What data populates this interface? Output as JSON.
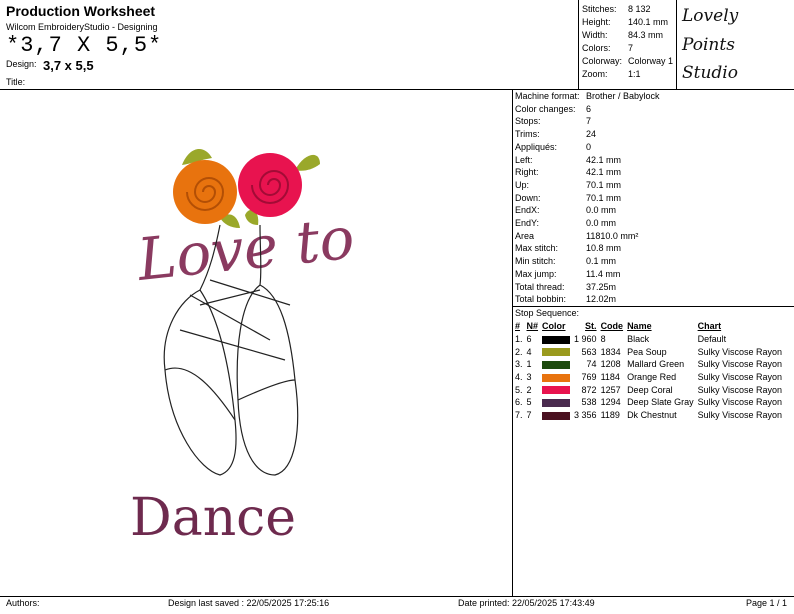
{
  "header": {
    "title": "Production Worksheet",
    "subtitle": "Wilcom EmbroideryStudio - Designing",
    "design_big": "*3,7 X 5,5*",
    "design_label": "Design:",
    "design_value": "3,7 x 5,5",
    "title_label": "Title:"
  },
  "summary": [
    {
      "label": "Stitches:",
      "value": "8 132"
    },
    {
      "label": "Height:",
      "value": "140.1 mm"
    },
    {
      "label": "Width:",
      "value": "84.3 mm"
    },
    {
      "label": "Colors:",
      "value": "7"
    },
    {
      "label": "Colorway:",
      "value": "Colorway 1"
    },
    {
      "label": "Zoom:",
      "value": "1:1"
    }
  ],
  "logo": {
    "line1": "Lovely",
    "line2": "Points",
    "line3": "Studio"
  },
  "machine": [
    {
      "label": "Machine format:",
      "value": "Brother / Babylock"
    },
    {
      "label": "Color changes:",
      "value": "6"
    },
    {
      "label": "Stops:",
      "value": "7"
    },
    {
      "label": "Trims:",
      "value": "24"
    },
    {
      "label": "Appliqués:",
      "value": "0"
    },
    {
      "label": "Left:",
      "value": "42.1 mm"
    },
    {
      "label": "Right:",
      "value": "42.1 mm"
    },
    {
      "label": "Up:",
      "value": "70.1 mm"
    },
    {
      "label": "Down:",
      "value": "70.1 mm"
    },
    {
      "label": "EndX:",
      "value": "0.0 mm"
    },
    {
      "label": "EndY:",
      "value": "0.0 mm"
    },
    {
      "label": "Area",
      "value": "11810.0 mm²"
    },
    {
      "label": "Max stitch:",
      "value": "10.8 mm"
    },
    {
      "label": "Min stitch:",
      "value": "0.1 mm"
    },
    {
      "label": "Max jump:",
      "value": "11.4 mm"
    },
    {
      "label": "Total thread:",
      "value": "37.25m"
    },
    {
      "label": "Total bobbin:",
      "value": "12.02m"
    }
  ],
  "stop_sequence": {
    "title": "Stop Sequence:",
    "headers": {
      "num": "#",
      "n": "N#",
      "color": "Color",
      "st": "St.",
      "code": "Code",
      "name": "Name",
      "chart": "Chart"
    },
    "rows": [
      {
        "num": "1.",
        "n": "6",
        "color": "#000000",
        "st": "1 960",
        "code": "8",
        "name": "Black",
        "chart": "Default"
      },
      {
        "num": "2.",
        "n": "4",
        "color": "#9a9a1e",
        "st": "563",
        "code": "1834",
        "name": "Pea Soup",
        "chart": "Sulky Viscose Rayon"
      },
      {
        "num": "3.",
        "n": "1",
        "color": "#1d4a0e",
        "st": "74",
        "code": "1208",
        "name": "Mallard Green",
        "chart": "Sulky Viscose Rayon"
      },
      {
        "num": "4.",
        "n": "3",
        "color": "#e8730e",
        "st": "769",
        "code": "1184",
        "name": "Orange Red",
        "chart": "Sulky Viscose Rayon"
      },
      {
        "num": "5.",
        "n": "2",
        "color": "#e8134f",
        "st": "872",
        "code": "1257",
        "name": "Deep Coral",
        "chart": "Sulky Viscose Rayon"
      },
      {
        "num": "6.",
        "n": "5",
        "color": "#4a2a4e",
        "st": "538",
        "code": "1294",
        "name": "Deep Slate Gray",
        "chart": "Sulky Viscose Rayon"
      },
      {
        "num": "7.",
        "n": "7",
        "color": "#4a1020",
        "st": "3 356",
        "code": "1189",
        "name": "Dk Chestnut",
        "chart": "Sulky Viscose Rayon"
      }
    ]
  },
  "design_art": {
    "script_text": "Love to",
    "bottom_text": "Dance"
  },
  "footer": {
    "authors": "Authors:",
    "saved": "Design last saved : 22/05/2025 17:25:16",
    "printed": "Date printed: 22/05/2025 17:43:49",
    "page": "Page 1 / 1"
  }
}
